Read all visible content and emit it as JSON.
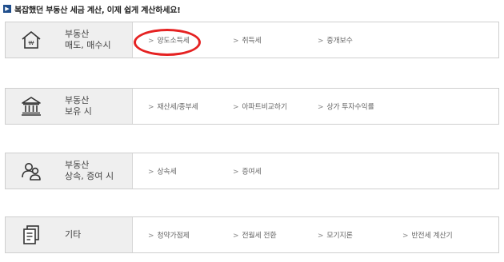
{
  "header": {
    "mark": "▶",
    "text": "복잡했던 부동산 세금 계산, 이제 쉽게 계산하세요!"
  },
  "sections": [
    {
      "icon": "house-won-icon",
      "title_line1": "부동산",
      "title_line2": "매도, 매수시",
      "links": [
        "양도소득세",
        "취득세",
        "중개보수"
      ]
    },
    {
      "icon": "bank-building-icon",
      "title_line1": "부동산",
      "title_line2": "보유 시",
      "links": [
        "재산세/종부세",
        "아파트비교하기",
        "상가 투자수익률"
      ]
    },
    {
      "icon": "people-icon",
      "title_line1": "부동산",
      "title_line2": "상속, 증여 시",
      "links": [
        "상속세",
        "증여세"
      ]
    },
    {
      "icon": "documents-icon",
      "title_line1": "기타",
      "links": [
        "청약가점제",
        "전월세 전환",
        "모기지론",
        "반전세 계산기"
      ]
    }
  ],
  "chevron": ">",
  "colors": {
    "highlight": "#e52222",
    "left_bg": "#efefef",
    "border": "#cfcfcf"
  }
}
